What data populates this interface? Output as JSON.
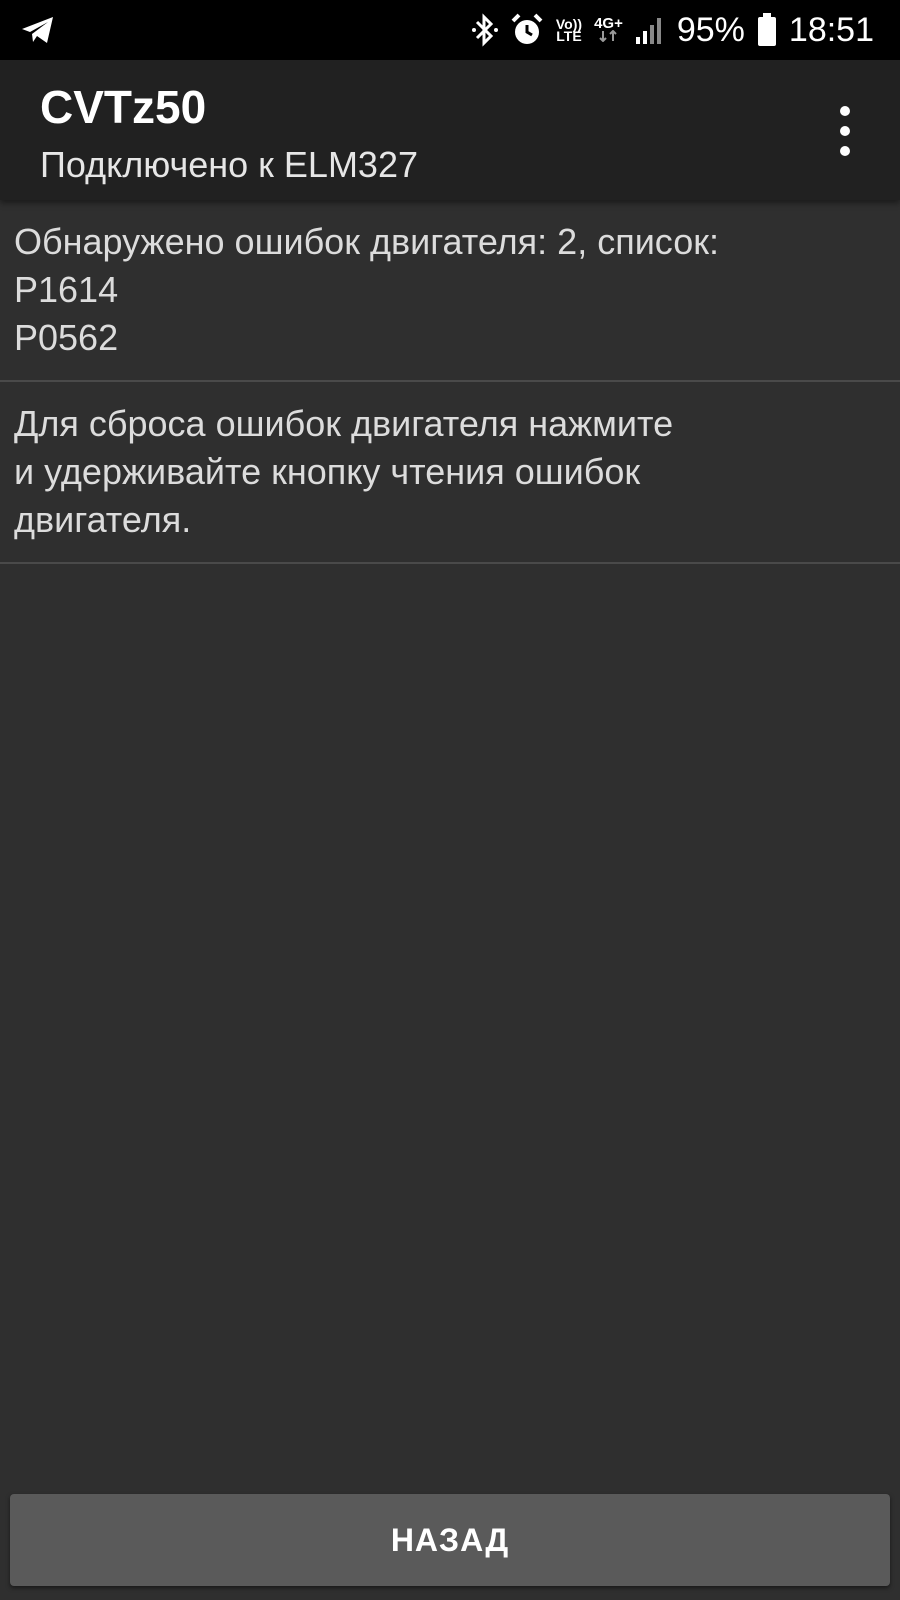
{
  "status_bar": {
    "left_icon": "telegram-icon",
    "icons": [
      "bluetooth-icon",
      "alarm-icon",
      "volte-icon",
      "4g-plus-icon",
      "signal-icon",
      "battery-icon"
    ],
    "volte_top": "Vo))",
    "volte_bottom": "LTE",
    "network_type": "4G+",
    "battery_percent": "95%",
    "time": "18:51"
  },
  "app_bar": {
    "title": "CVTz50",
    "subtitle": "Подключено к ELM327",
    "menu_icon": "overflow-menu-icon"
  },
  "errors": {
    "summary": "Обнаружено ошибок двигателя: 2, список:",
    "codes": [
      "P1614",
      "P0562"
    ]
  },
  "hint": {
    "lines": [
      "Для сброса ошибок двигателя нажмите",
      "и удерживайте кнопку чтения ошибок",
      "двигателя."
    ]
  },
  "back_button": {
    "label": "НАЗАД"
  },
  "colors": {
    "background": "#2f2f2f",
    "app_bar": "#212121",
    "status_bar": "#000000",
    "button": "#5a5a5a",
    "divider": "#4a4a4a"
  }
}
